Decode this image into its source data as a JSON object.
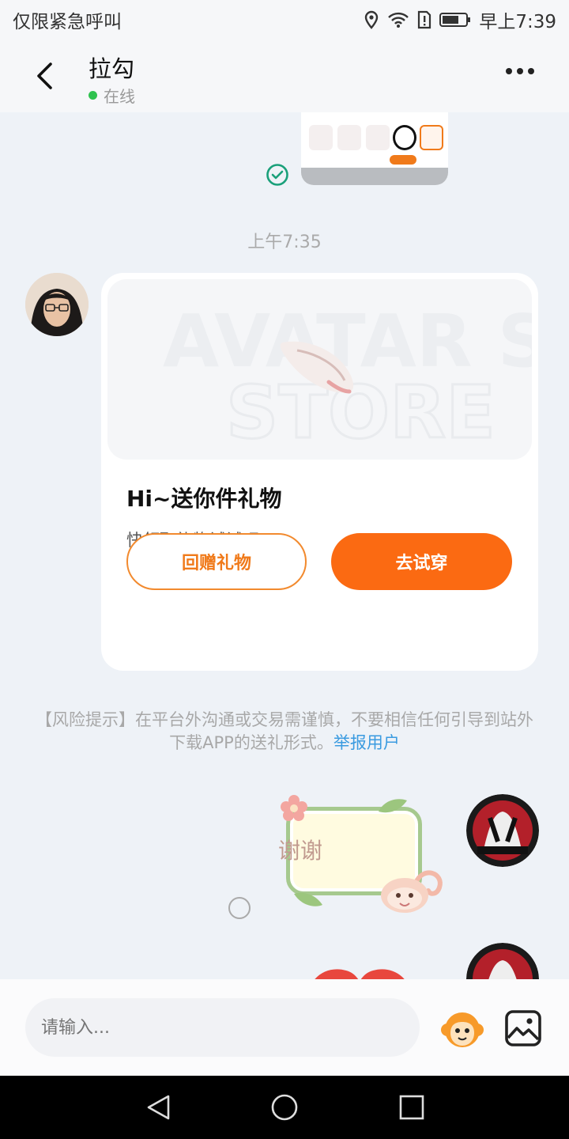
{
  "status_bar": {
    "left_text": "仅限紧急呼叫",
    "time": "早上7:39"
  },
  "header": {
    "title": "拉勾",
    "status": "在线"
  },
  "chat": {
    "timestamp": "上午7:35",
    "gift_card": {
      "image_watermark": "AVATAR STORE",
      "title": "Hi~送你件礼物",
      "subtitle": "快领取礼物试试吧~",
      "return_gift_label": "回赠礼物",
      "try_on_label": "去试穿"
    },
    "risk_notice": {
      "text": "【风险提示】在平台外沟通或交易需谨慎，不要相信任何引导到站外下载APP的送礼形式。",
      "link": "举报用户"
    },
    "sticker_text": "谢谢"
  },
  "input_bar": {
    "placeholder": "请输入..."
  },
  "colors": {
    "accent": "#fb6a12",
    "online": "#2fc24f",
    "link": "#3a9be0"
  }
}
